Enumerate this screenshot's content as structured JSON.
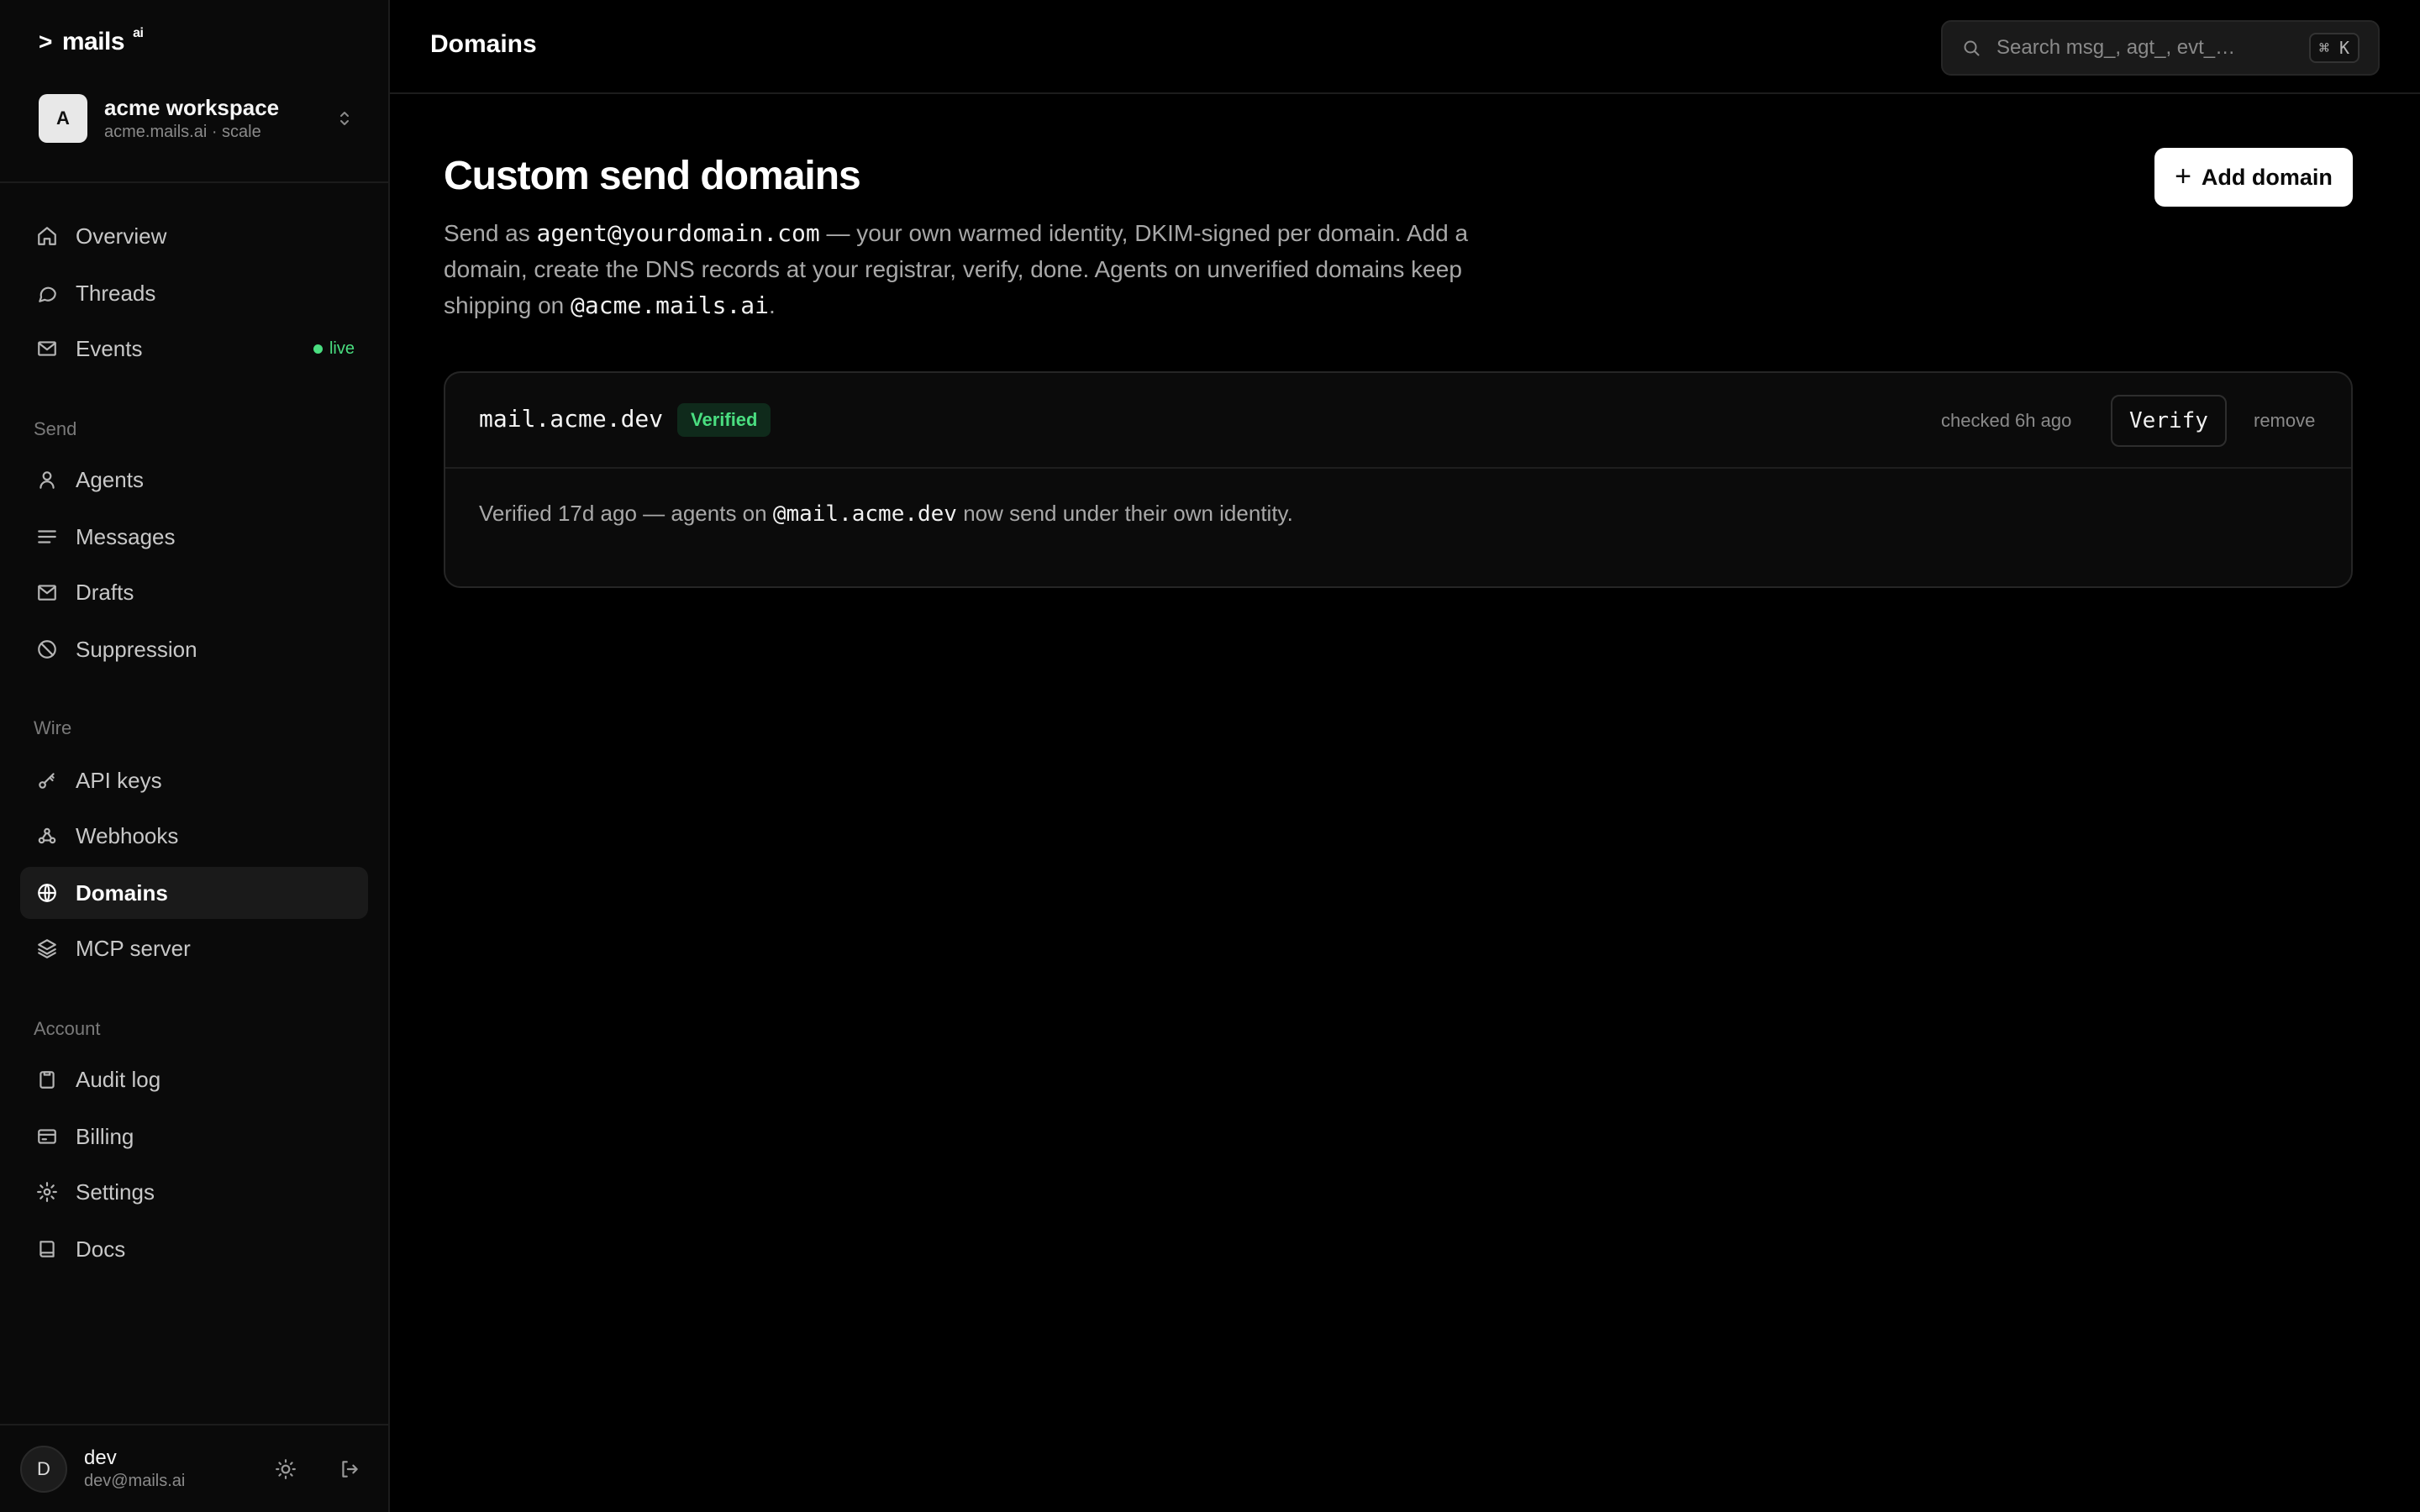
{
  "brand": {
    "name": "mails",
    "sup": "ai"
  },
  "workspace": {
    "initial": "A",
    "name": "acme workspace",
    "subtitle": "acme.mails.ai · scale"
  },
  "nav": {
    "overview": "Overview",
    "threads": "Threads",
    "events": "Events",
    "events_badge": "live",
    "send_section": "Send",
    "agents": "Agents",
    "messages": "Messages",
    "drafts": "Drafts",
    "suppression": "Suppression",
    "wire_section": "Wire",
    "api_keys": "API keys",
    "webhooks": "Webhooks",
    "domains": "Domains",
    "mcp_server": "MCP server",
    "account_section": "Account",
    "audit_log": "Audit log",
    "billing": "Billing",
    "settings": "Settings",
    "docs": "Docs"
  },
  "user": {
    "initial": "D",
    "name": "dev",
    "email": "dev@mails.ai"
  },
  "topbar": {
    "title": "Domains",
    "search_placeholder": "Search msg_, agt_, evt_…",
    "shortcut": "⌘ K"
  },
  "page": {
    "title": "Custom send domains",
    "desc_1": "Send as ",
    "desc_code_1": "agent@yourdomain.com",
    "desc_2": " — your own warmed identity, DKIM-signed per domain. Add a domain, create the DNS records at your registrar, verify, done. Agents on unverified domains keep shipping on ",
    "desc_code_2": "@acme.mails.ai",
    "desc_3": ".",
    "add_button": "Add domain"
  },
  "domains": [
    {
      "name": "mail.acme.dev",
      "status": "Verified",
      "checked": "checked 6h ago",
      "verify_label": "Verify",
      "remove_label": "remove",
      "note_1": "Verified 17d ago — agents on ",
      "note_code": "@mail.acme.dev",
      "note_2": " now send under their own identity."
    }
  ],
  "colors": {
    "accent_green": "#4ade80",
    "background": "#000000",
    "sidebar": "#0a0a0a"
  }
}
